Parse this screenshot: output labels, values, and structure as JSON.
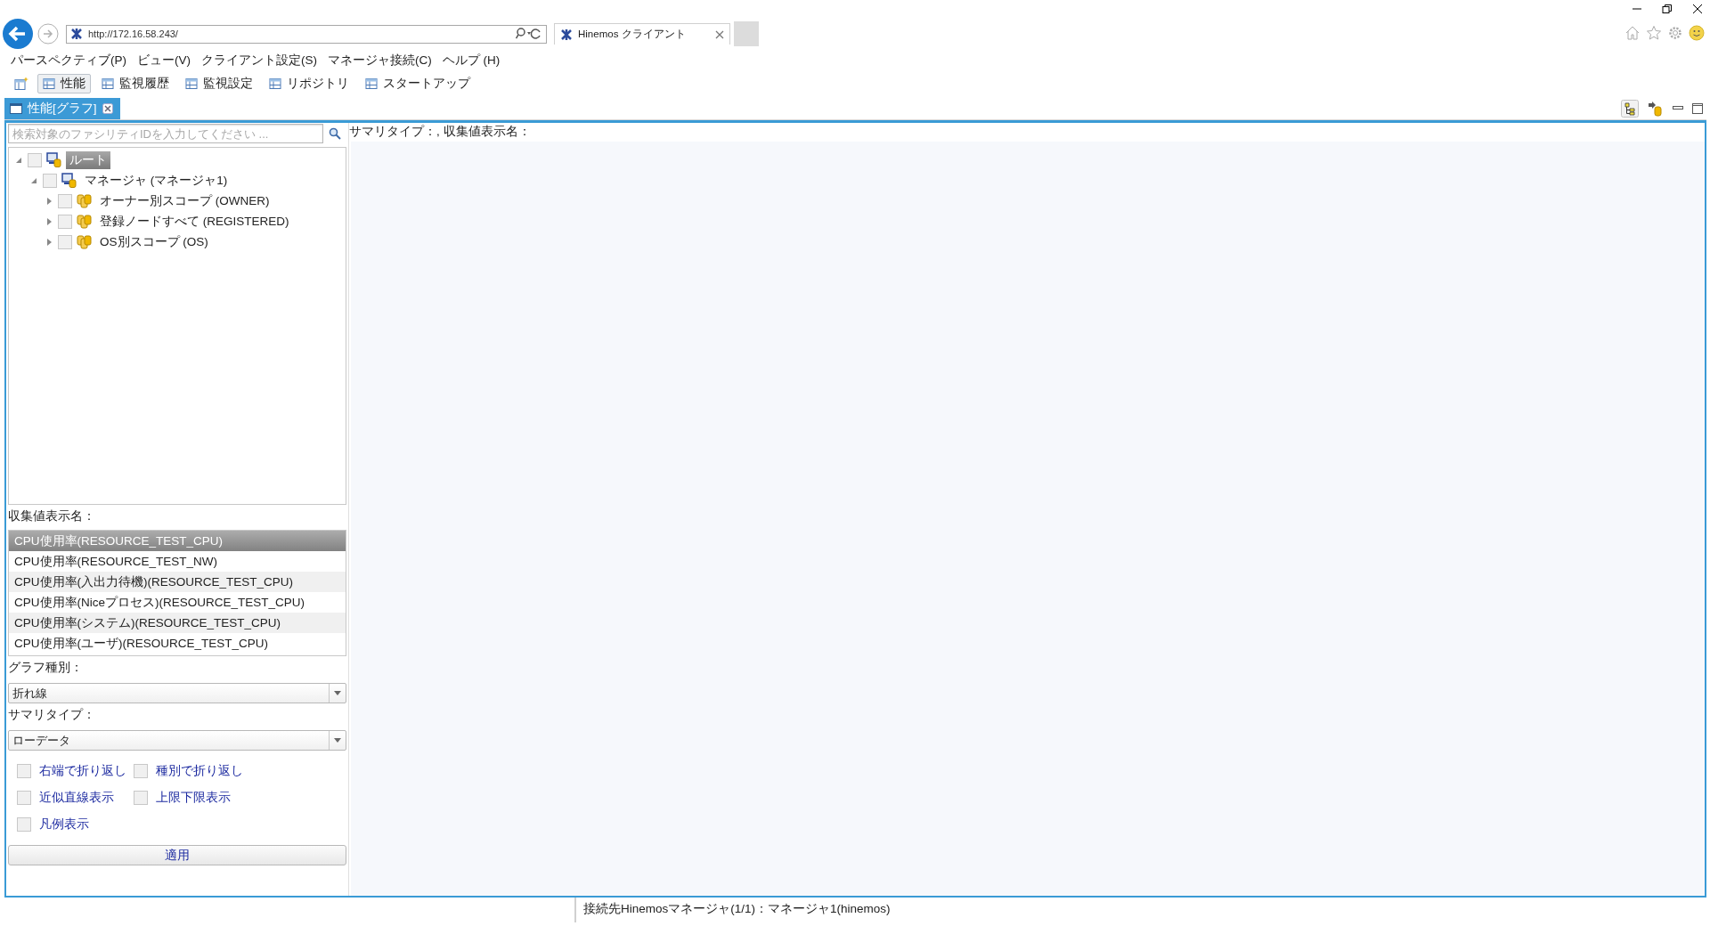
{
  "browser": {
    "address": "http://172.16.58.243/",
    "tab_title": "Hinemos クライアント"
  },
  "menu": [
    "パースペクティブ(P)",
    "ビュー(V)",
    "クライアント設定(S)",
    "マネージャ接続(C)",
    "ヘルプ (H)"
  ],
  "perspectives": [
    {
      "label": "性能",
      "selected": true
    },
    {
      "label": "監視履歴",
      "selected": false
    },
    {
      "label": "監視設定",
      "selected": false
    },
    {
      "label": "リポジトリ",
      "selected": false
    },
    {
      "label": "スタートアップ",
      "selected": false
    }
  ],
  "editor_tab": {
    "title": "性能[グラフ]",
    "selected": true
  },
  "facility_search": {
    "placeholder": "検索対象のファシリティIDを入力してください ..."
  },
  "tree": [
    {
      "label": "ルート",
      "kind": "node",
      "selected": true,
      "checked": false,
      "expanded": true,
      "children": [
        {
          "label": "マネージャ (マネージャ1)",
          "kind": "node",
          "selected": false,
          "checked": false,
          "expanded": true,
          "children": [
            {
              "label": "オーナー別スコープ (OWNER)",
              "kind": "scope",
              "selected": false,
              "checked": false,
              "expanded": false
            },
            {
              "label": "登録ノードすべて (REGISTERED)",
              "kind": "scope",
              "selected": false,
              "checked": false,
              "expanded": false
            },
            {
              "label": "OS別スコープ (OS)",
              "kind": "scope",
              "selected": false,
              "checked": false,
              "expanded": false
            }
          ]
        }
      ]
    }
  ],
  "collected_values": {
    "label": "収集値表示名：",
    "items": [
      {
        "text": "CPU使用率(RESOURCE_TEST_CPU)",
        "selected": true
      },
      {
        "text": "CPU使用率(RESOURCE_TEST_NW)",
        "selected": false
      },
      {
        "text": "CPU使用率(入出力待機)(RESOURCE_TEST_CPU)",
        "selected": false
      },
      {
        "text": "CPU使用率(Niceプロセス)(RESOURCE_TEST_CPU)",
        "selected": false
      },
      {
        "text": "CPU使用率(システム)(RESOURCE_TEST_CPU)",
        "selected": false
      },
      {
        "text": "CPU使用率(ユーザ)(RESOURCE_TEST_CPU)",
        "selected": false
      }
    ]
  },
  "graph_type": {
    "label": "グラフ種別：",
    "value": "折れ線"
  },
  "summary_type": {
    "label": "サマリタイプ：",
    "value": "ローデータ"
  },
  "options": [
    {
      "label": "右端で折り返し",
      "checked": false
    },
    {
      "label": "種別で折り返し",
      "checked": false
    },
    {
      "label": "近似直線表示",
      "checked": false
    },
    {
      "label": "上限下限表示",
      "checked": false
    },
    {
      "label": "凡例表示",
      "checked": false
    }
  ],
  "apply_button": "適用",
  "graph_header": "サマリタイプ：,  収集値表示名：",
  "status_bar": "接続先Hinemosマネージャ(1/1)：マネージャ1(hinemos)"
}
